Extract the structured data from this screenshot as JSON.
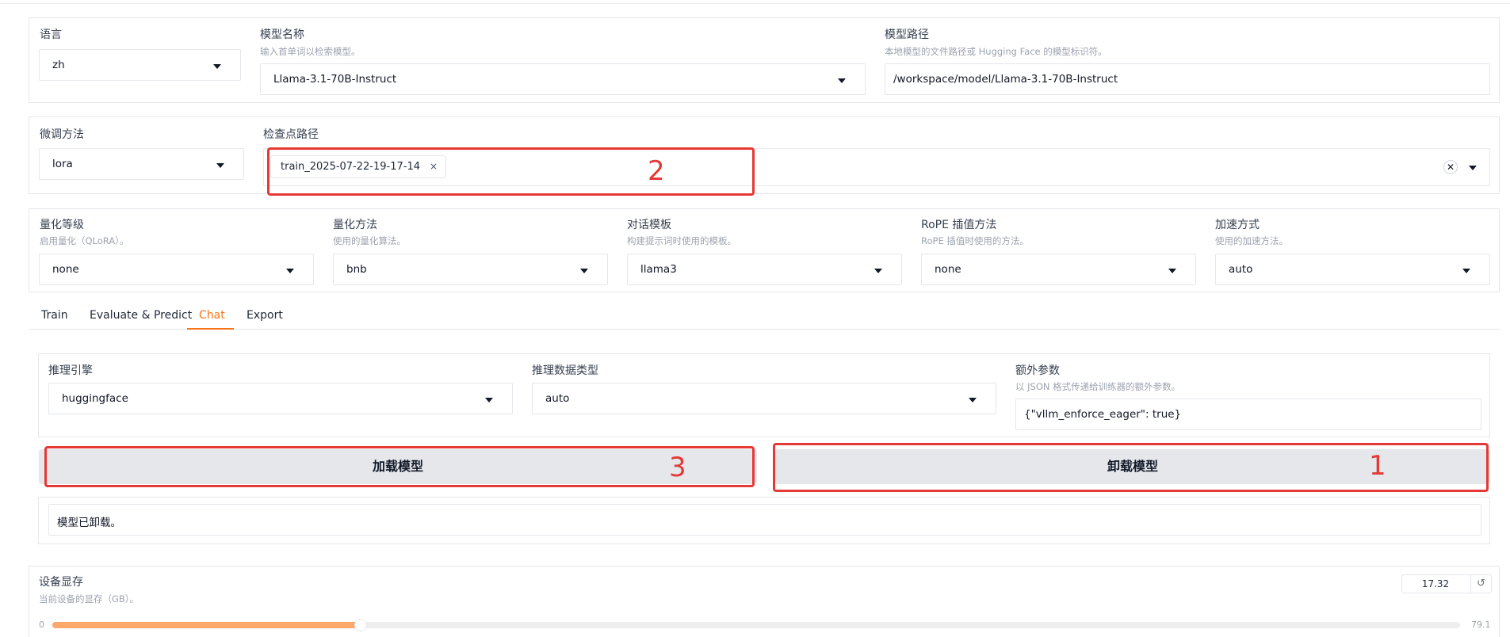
{
  "top_panel": {
    "language": {
      "label": "语言",
      "value": "zh"
    },
    "model_name": {
      "label": "模型名称",
      "info": "输入首单词以检索模型。",
      "value": "Llama-3.1-70B-Instruct"
    },
    "model_path": {
      "label": "模型路径",
      "info": "本地模型的文件路径或 Hugging Face 的模型标识符。",
      "value": "/workspace/model/Llama-3.1-70B-Instruct"
    }
  },
  "finetune_panel": {
    "method": {
      "label": "微调方法",
      "value": "lora"
    },
    "checkpoint": {
      "label": "检查点路径",
      "chips": [
        "train_2025-07-22-19-17-14"
      ],
      "chip_remove": "×",
      "clear": "✕"
    }
  },
  "advanced_panel": {
    "quantization_bit": {
      "label": "量化等级",
      "info": "启用量化（QLoRA）。",
      "value": "none"
    },
    "quantization_method": {
      "label": "量化方法",
      "info": "使用的量化算法。",
      "value": "bnb"
    },
    "template": {
      "label": "对话模板",
      "info": "构建提示词时使用的模板。",
      "value": "llama3"
    },
    "rope_scaling": {
      "label": "RoPE 插值方法",
      "info": "RoPE 插值时使用的方法。",
      "value": "none"
    },
    "booster": {
      "label": "加速方式",
      "info": "使用的加速方法。",
      "value": "auto"
    }
  },
  "tabs": [
    {
      "label": "Train",
      "active": false
    },
    {
      "label": "Evaluate & Predict",
      "active": false
    },
    {
      "label": "Chat",
      "active": true
    },
    {
      "label": "Export",
      "active": false
    }
  ],
  "chat": {
    "infer_backend": {
      "label": "推理引擎",
      "value": "huggingface"
    },
    "infer_dtype": {
      "label": "推理数据类型",
      "value": "auto"
    },
    "extra_args": {
      "label": "额外参数",
      "info": "以 JSON 格式传递给训练器的额外参数。",
      "value": "{\"vllm_enforce_eager\": true}"
    },
    "load_button": "加载模型",
    "unload_button": "卸载模型",
    "status": "模型已卸载。"
  },
  "gpu_memory": {
    "label": "设备显存",
    "info": "当前设备的显存（GB）。",
    "value": "17.32",
    "reset_icon": "↺",
    "min": "0",
    "max": "79.1",
    "fraction": 0.219
  },
  "annotations": [
    {
      "number": "1",
      "target": "unload-button"
    },
    {
      "number": "2",
      "target": "checkpoint-path-field"
    },
    {
      "number": "3",
      "target": "load-button"
    }
  ],
  "colors": {
    "accent": "#f97316",
    "slider_fill": "#fca86b",
    "annotation": "#e53935",
    "button_bg": "#e5e7eb"
  }
}
